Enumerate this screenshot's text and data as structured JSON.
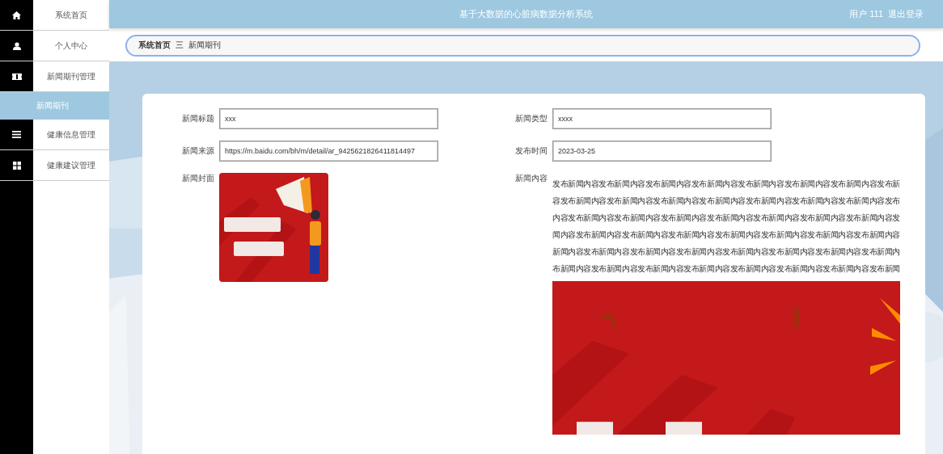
{
  "sidebar": {
    "items": [
      {
        "label": "系统首页",
        "selected": false
      },
      {
        "label": "个人中心",
        "selected": false
      },
      {
        "label": "新闻期刊管理",
        "selected": false,
        "expanded": true,
        "children": [
          {
            "label": "新闻期刊",
            "selected": true
          }
        ]
      },
      {
        "label": "健康信息管理",
        "selected": false
      },
      {
        "label": "健康建议管理",
        "selected": false
      }
    ]
  },
  "header": {
    "title": "基于大数据的心脏病数据分析系统",
    "user": "用户 111",
    "logout": "退出登录"
  },
  "breadcrumb": {
    "items": [
      "系统首页",
      "新闻期刊"
    ],
    "separator": "三"
  },
  "form": {
    "fields": [
      {
        "label": "新闻标题",
        "kind": "input",
        "value": "xxx"
      },
      {
        "label": "新闻类型",
        "kind": "input",
        "value": "xxxx"
      },
      {
        "label": "新闻来源",
        "kind": "input",
        "value": "https://m.baidu.com/bh/m/detail/ar_9425621826411814497"
      },
      {
        "label": "发布时间",
        "kind": "input",
        "value": "2023-03-25"
      },
      {
        "label": "新闻封面"
      },
      {
        "label": "新闻内容",
        "kind": "content",
        "lines": [
          "发布新闻内容发布新闻内容发布新闻内容发布新闻内容发布新闻内容发布新闻内容发布新闻内容发布新",
          "容发布新闻内容发布新闻内容发布新闻内容发布新闻内容发布新闻内容发布新闻内容发布新闻内容发布",
          "内容发布新闻内容发布新闻内容发布新闻内容发布新闻内容发布新闻内容发布新闻内容发布新闻内容发",
          "闻内容发布新闻内容发布新闻内容发布新闻内容发布新闻内容发布新闻内容发布新闻内容发布新闻内容",
          "新闻内容发布新闻内容发布新闻内容发布新闻内容发布新闻内容发布新闻内容发布新闻内容发布新闻内",
          "布新闻内容发布新闻内容发布新闻内容发布新闻内容发布新闻内容发布新闻内容发布新闻内容发布新闻"
        ]
      }
    ]
  }
}
